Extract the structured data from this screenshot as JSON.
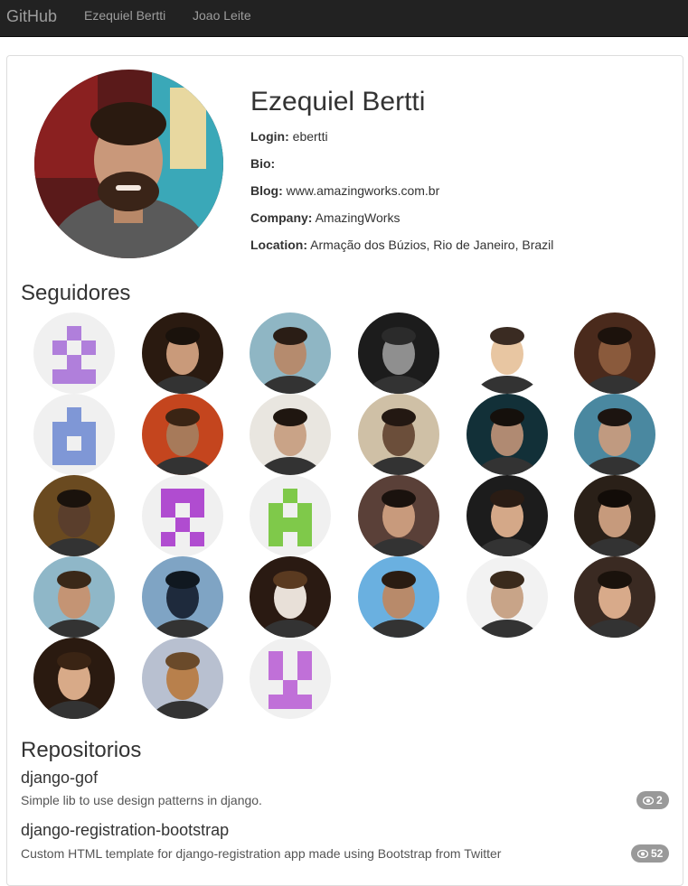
{
  "navbar": {
    "brand": "GitHub",
    "links": [
      "Ezequiel Bertti",
      "Joao Leite"
    ]
  },
  "profile": {
    "name": "Ezequiel Bertti",
    "fields": [
      {
        "label": "Login:",
        "value": "ebertti"
      },
      {
        "label": "Bio:",
        "value": ""
      },
      {
        "label": "Blog:",
        "value": "www.amazingworks.com.br"
      },
      {
        "label": "Company:",
        "value": "AmazingWorks"
      },
      {
        "label": "Location:",
        "value": "Armação dos Búzios, Rio de Janeiro, Brazil"
      }
    ]
  },
  "followers_section": {
    "title": "Seguidores",
    "followers": [
      {
        "kind": "identicon",
        "color": "#b07fdb",
        "pattern": "a"
      },
      {
        "kind": "photo",
        "bg": "#2a1a10",
        "skin": "#c99a7a",
        "hair": "#1a120c"
      },
      {
        "kind": "photo",
        "bg": "#8fb6c4",
        "skin": "#b58b6e",
        "hair": "#2a1d15"
      },
      {
        "kind": "photo",
        "bg": "#1c1c1c",
        "skin": "#8f8f8f",
        "hair": "#2b2b2b"
      },
      {
        "kind": "photo",
        "bg": "#ffffff",
        "skin": "#e8c6a2",
        "hair": "#3a2b22"
      },
      {
        "kind": "photo",
        "bg": "#4a2a1c",
        "skin": "#8a5a3c",
        "hair": "#1c120c"
      },
      {
        "kind": "identicon",
        "color": "#7f97d6",
        "pattern": "b"
      },
      {
        "kind": "photo",
        "bg": "#c4451e",
        "skin": "#a77a5a",
        "hair": "#3a2414"
      },
      {
        "kind": "photo",
        "bg": "#e9e6e0",
        "skin": "#c9a387",
        "hair": "#1f1610"
      },
      {
        "kind": "photo",
        "bg": "#cfc0a6",
        "skin": "#6b4e3a",
        "hair": "#231812"
      },
      {
        "kind": "photo",
        "bg": "#123038",
        "skin": "#b08a72",
        "hair": "#15100c"
      },
      {
        "kind": "photo",
        "bg": "#4a88a0",
        "skin": "#c09a80",
        "hair": "#1c1410"
      },
      {
        "kind": "photo",
        "bg": "#6a4a20",
        "skin": "#5a3e2c",
        "hair": "#1a120c"
      },
      {
        "kind": "identicon",
        "color": "#b04cd0",
        "pattern": "c"
      },
      {
        "kind": "identicon",
        "color": "#7fc94a",
        "pattern": "d"
      },
      {
        "kind": "photo",
        "bg": "#5a4038",
        "skin": "#c89a7c",
        "hair": "#1a120e"
      },
      {
        "kind": "photo",
        "bg": "#1c1c1c",
        "skin": "#d4a888",
        "hair": "#2a1c14"
      },
      {
        "kind": "photo",
        "bg": "#2a2018",
        "skin": "#c69a7c",
        "hair": "#120c08"
      },
      {
        "kind": "photo",
        "bg": "#8fb7c8",
        "skin": "#c49474",
        "hair": "#3a2818"
      },
      {
        "kind": "photo",
        "bg": "#7fa4c4",
        "skin": "#1e2a3c",
        "hair": "#101820"
      },
      {
        "kind": "photo",
        "bg": "#2a1a12",
        "skin": "#e8e0d8",
        "hair": "#5a3a20"
      },
      {
        "kind": "photo",
        "bg": "#6ab0e0",
        "skin": "#b88a6a",
        "hair": "#2a1c12"
      },
      {
        "kind": "photo",
        "bg": "#f2f2f2",
        "skin": "#c8a488",
        "hair": "#3a2a1c"
      },
      {
        "kind": "photo",
        "bg": "#3a2a22",
        "skin": "#d8aa8a",
        "hair": "#1a120c"
      },
      {
        "kind": "photo",
        "bg": "#2a1a10",
        "skin": "#d8aa88",
        "hair": "#3a2414"
      },
      {
        "kind": "photo",
        "bg": "#b8c0d0",
        "skin": "#b8804c",
        "hair": "#6a4a2a"
      },
      {
        "kind": "identicon",
        "color": "#c070d8",
        "pattern": "e"
      }
    ]
  },
  "repos_section": {
    "title": "Repositorios",
    "repos": [
      {
        "name": "django-gof",
        "description": "Simple lib to use design patterns in django.",
        "watchers": "2"
      },
      {
        "name": "django-registration-bootstrap",
        "description": "Custom HTML template for django-registration app made using Bootstrap from Twitter",
        "watchers": "52"
      }
    ]
  },
  "icons": {
    "watchers": "eye-icon"
  }
}
